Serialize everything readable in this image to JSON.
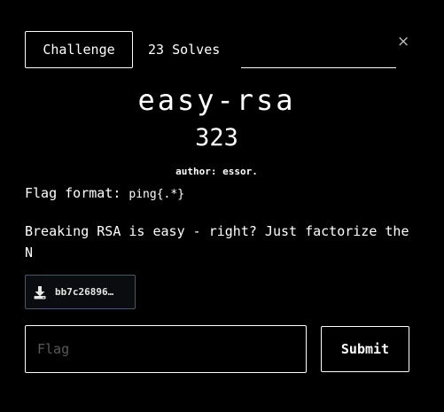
{
  "tabs": [
    {
      "label": "Challenge",
      "active": true
    },
    {
      "label": "23 Solves",
      "active": false
    }
  ],
  "close_glyph": "×",
  "challenge": {
    "name": "easy-rsa",
    "points": "323",
    "author": "author: essor.",
    "description": {
      "format_prefix": "Flag format: ",
      "format_code": "ping{.*}",
      "body": "Breaking RSA is easy - right? Just factorize the N"
    },
    "file": {
      "icon": "download-icon",
      "name": "bb7c26896…"
    }
  },
  "form": {
    "flag_placeholder": "Flag",
    "flag_value": "",
    "submit_label": "Submit"
  },
  "colors": {
    "background": "#000000",
    "foreground": "#ffffff",
    "file_border": "#4a5866",
    "placeholder": "#5a5a5a"
  }
}
